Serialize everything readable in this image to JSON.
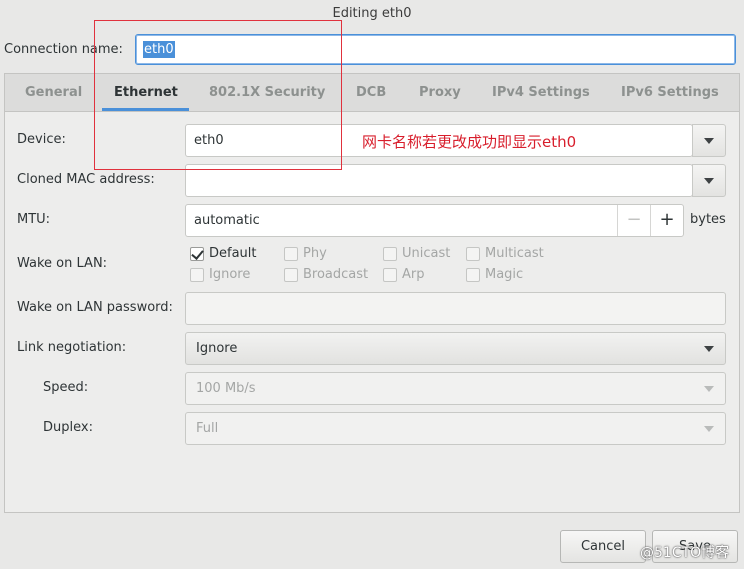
{
  "window": {
    "title": "Editing eth0"
  },
  "connection": {
    "label": "Connection name:",
    "value": "eth0"
  },
  "tabs": [
    {
      "label": "General"
    },
    {
      "label": "Ethernet"
    },
    {
      "label": "802.1X Security"
    },
    {
      "label": "DCB"
    },
    {
      "label": "Proxy"
    },
    {
      "label": "IPv4 Settings"
    },
    {
      "label": "IPv6 Settings"
    }
  ],
  "active_tab": "Ethernet",
  "ethernet": {
    "device": {
      "label": "Device:",
      "value": "eth0"
    },
    "cloned_mac": {
      "label": "Cloned MAC address:",
      "value": ""
    },
    "mtu": {
      "label": "MTU:",
      "value": "automatic",
      "minus": "−",
      "plus": "+",
      "unit": "bytes"
    },
    "wake_on_lan": {
      "label": "Wake on LAN:",
      "options": [
        {
          "label": "Default",
          "checked": true
        },
        {
          "label": "Phy",
          "checked": false
        },
        {
          "label": "Unicast",
          "checked": false
        },
        {
          "label": "Multicast",
          "checked": false
        },
        {
          "label": "Ignore",
          "checked": false
        },
        {
          "label": "Broadcast",
          "checked": false
        },
        {
          "label": "Arp",
          "checked": false
        },
        {
          "label": "Magic",
          "checked": false
        }
      ]
    },
    "wol_password": {
      "label": "Wake on LAN password:",
      "value": ""
    },
    "link_negotiation": {
      "label": "Link negotiation:",
      "value": "Ignore"
    },
    "speed": {
      "label": "Speed:",
      "value": "100 Mb/s"
    },
    "duplex": {
      "label": "Duplex:",
      "value": "Full"
    }
  },
  "buttons": {
    "cancel": "Cancel",
    "save": "Save"
  },
  "annotation": {
    "text": "网卡名称若更改成功即显示eth0",
    "color": "#d81e2c"
  },
  "watermark": "@51CTO博客",
  "colors": {
    "accent": "#4a90d9",
    "annotation": "#e0313d"
  }
}
